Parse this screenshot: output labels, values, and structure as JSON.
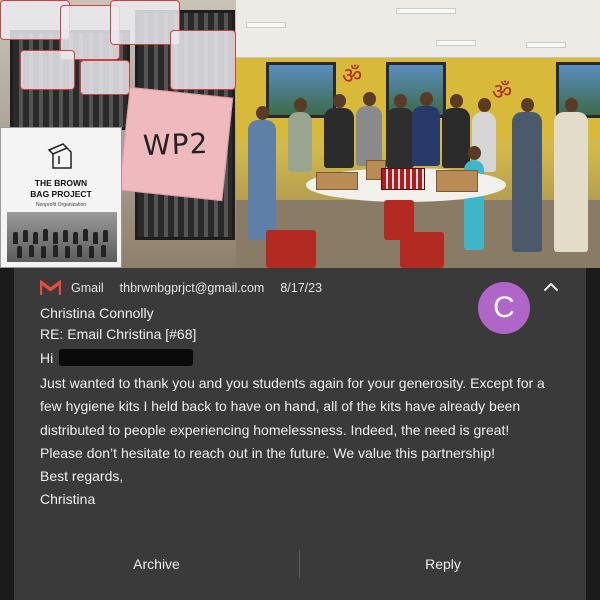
{
  "collage": {
    "crate_label": "WP2",
    "flyer": {
      "title_line1": "THE BROWN",
      "title_line2": "BAG PROJECT",
      "subtitle": "Nonprofit Organization"
    }
  },
  "notification": {
    "app_name": "Gmail",
    "account": "thbrwnbgprjct@gmail.com",
    "date": "8/17/23",
    "avatar_letter": "C",
    "avatar_color": "#b066c9",
    "sender": "Christina Connolly",
    "subject": "RE: Email Christina [#68]",
    "greeting": "Hi",
    "paragraphs": [
      "Just wanted to thank you and you students again for your generosity. Except for a few hygiene kits I held back to have on hand, all of the kits have already been distributed to people experiencing homelessness.  Indeed, the need is great!",
      "Please don’t hesitate to reach out in the future. We value this partnership!",
      "Best regards,",
      "Christina"
    ],
    "actions": {
      "archive": "Archive",
      "reply": "Reply"
    },
    "icons": {
      "app": "gmail-icon",
      "collapse": "chevron-up-icon"
    }
  }
}
